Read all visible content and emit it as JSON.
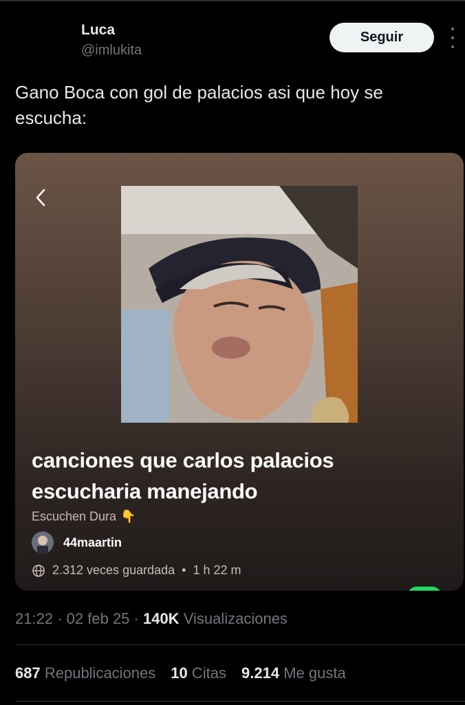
{
  "tweet": {
    "author_name": "Luca",
    "author_handle": "@imlukita",
    "follow_label": "Seguir",
    "text": "Gano Boca con gol de palacios asi que hoy se escucha:",
    "time": "21:22",
    "date": "02 feb 25",
    "views_count": "140K",
    "views_label": "Visualizaciones"
  },
  "card": {
    "playlist_title": "canciones que carlos palacios escucharia manejando",
    "description": "Escuchen Dura",
    "description_emoji": "👇",
    "owner": "44maartin",
    "saves": "2.312 veces guardada",
    "duration": "1 h 22 m",
    "background_color": "#5e4a3f"
  },
  "stats": {
    "reposts_count": "687",
    "reposts_label": "Republicaciones",
    "quotes_count": "10",
    "quotes_label": "Citas",
    "likes_count": "9.214",
    "likes_label": "Me gusta"
  },
  "icons": [
    "more-options-icon",
    "back-chevron-icon",
    "globe-icon"
  ]
}
